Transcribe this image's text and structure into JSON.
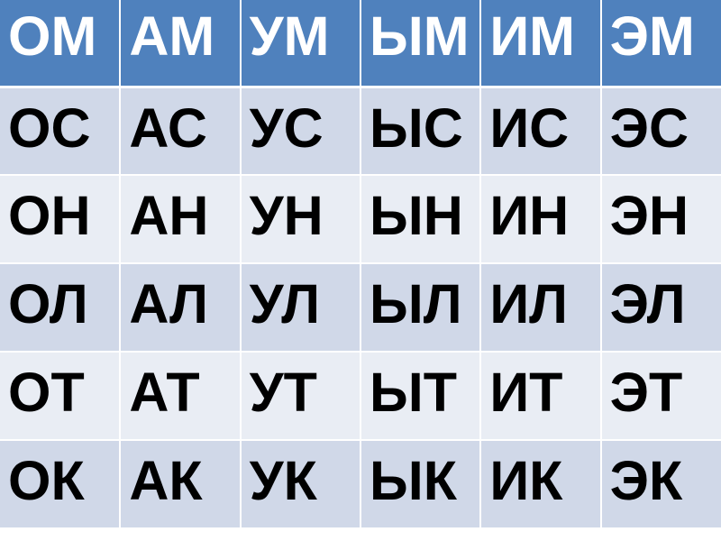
{
  "colors": {
    "header_bg": "#4f81bd",
    "header_text": "#ffffff",
    "row_odd_bg": "#d0d8e8",
    "row_even_bg": "#e9edf4",
    "body_text": "#000000",
    "grid_lines": "#ffffff"
  },
  "table": {
    "headers": [
      "ОМ",
      "АМ",
      "УМ",
      "ЫМ",
      "ИМ",
      "ЭМ"
    ],
    "rows": [
      [
        "ОС",
        "АС",
        "УС",
        "ЫС",
        "ИС",
        "ЭС"
      ],
      [
        "ОН",
        "АН",
        "УН",
        "ЫН",
        "ИН",
        "ЭН"
      ],
      [
        "ОЛ",
        "АЛ",
        "УЛ",
        "ЫЛ",
        "ИЛ",
        "ЭЛ"
      ],
      [
        "ОТ",
        "АТ",
        "УТ",
        "ЫТ",
        "ИТ",
        "ЭТ"
      ],
      [
        "ОК",
        "АК",
        "УК",
        "ЫК",
        "ИК",
        "ЭК"
      ]
    ]
  }
}
